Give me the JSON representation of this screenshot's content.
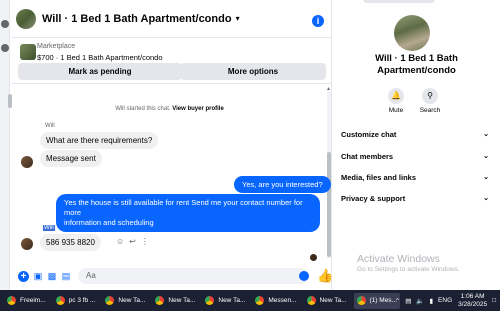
{
  "header": {
    "title": "Will · 1 Bed 1 Bath Apartment/condo"
  },
  "marketplace": {
    "label": "Marketplace",
    "listing": "$700 · 1 Bed 1 Bath Apartment/condo",
    "mark_pending": "Mark as pending",
    "more_options": "More options"
  },
  "messages": {
    "system": "Will started this chat.",
    "system_link": "View buyer profile",
    "sender": "Will",
    "m1": "What are there requirements?",
    "m2": "Message sent",
    "m3": "Yes, are you interested?",
    "m4_line1": "Yes the house is still available for rent Send me your contact number for more",
    "m4_line2": "information and  scheduling",
    "highlight": "Will",
    "m5": "586 935 8820"
  },
  "composer": {
    "placeholder": "Aa"
  },
  "panel": {
    "title_line1": "Will · 1 Bed 1 Bath",
    "title_line2": "Apartment/condo",
    "mute": "Mute",
    "search": "Search",
    "rows": [
      "Customize chat",
      "Chat members",
      "Media, files and links",
      "Privacy & support"
    ],
    "watermark1": "Activate Windows",
    "watermark2": "Go to Settings to activate Windows."
  },
  "taskbar": {
    "items": [
      "Freeim...",
      "pc 3 fb ...",
      "New Ta...",
      "New Ta...",
      "New Ta...",
      "Messen...",
      "New Ta...",
      "(1) Mes..."
    ],
    "lang": "ENG",
    "time": "1:06 AM",
    "date": "3/28/2025"
  },
  "colors": {
    "accent": "#0866ff",
    "bubble_in": "#f0f0f0",
    "taskbar": "#1c2033"
  }
}
